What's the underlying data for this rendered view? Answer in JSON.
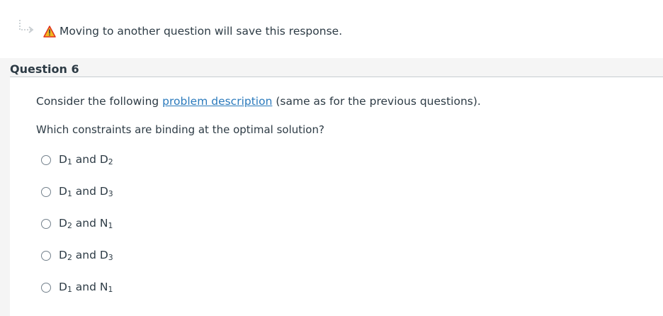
{
  "warning": {
    "text": "Moving to another question will save this response."
  },
  "question": {
    "title": "Question 6",
    "intro_before": "Consider the following ",
    "link_text": "problem description",
    "intro_after": " (same as for the previous questions).",
    "prompt": "Which constraints are binding at the optimal solution?"
  },
  "answers": [
    {
      "a": "D",
      "a_sub": "1",
      "and": " and ",
      "b": "D",
      "b_sub": "2"
    },
    {
      "a": "D",
      "a_sub": "1",
      "and": " and ",
      "b": "D",
      "b_sub": "3"
    },
    {
      "a": "D",
      "a_sub": "2",
      "and": " and ",
      "b": "N",
      "b_sub": "1"
    },
    {
      "a": "D",
      "a_sub": "2",
      "and": " and ",
      "b": "D",
      "b_sub": "3"
    },
    {
      "a": "D",
      "a_sub": "1",
      "and": " and ",
      "b": "N",
      "b_sub": "1"
    }
  ],
  "icons": {
    "return": "return-arrow-icon",
    "warning": "warning-icon"
  },
  "colors": {
    "link": "#2b7abc",
    "warning_fill": "#f3b61f",
    "warning_stroke": "#e0301e"
  }
}
